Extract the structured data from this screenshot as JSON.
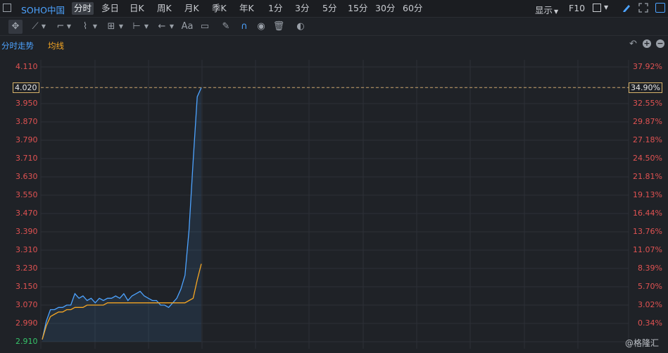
{
  "topbar": {
    "stock_name": "SOHO中国",
    "timeframes": [
      "分时",
      "多日",
      "日K",
      "周K",
      "月K",
      "季K",
      "年K",
      "1分",
      "3分",
      "5分",
      "15分",
      "30分",
      "60分"
    ],
    "active_timeframe": "分时",
    "display_label": "显示",
    "f10_label": "F10"
  },
  "toolbar": {
    "text_tool_label": "Aa"
  },
  "legend": {
    "price_line": "分时走势",
    "avg_line": "均线"
  },
  "colors": {
    "price_line": "#4da3ff",
    "avg_line": "#f5a623",
    "up": "#e05252",
    "down": "#36c46a",
    "current_price_line": "#caa36a"
  },
  "watermark": "@格隆汇",
  "chart_data": {
    "type": "line",
    "y_ticks": [
      "4.110",
      "4.020",
      "3.950",
      "3.870",
      "3.790",
      "3.710",
      "3.630",
      "3.550",
      "3.470",
      "3.390",
      "3.310",
      "3.230",
      "3.150",
      "3.070",
      "2.990",
      "2.910"
    ],
    "pct_ticks": [
      "37.92%",
      "34.90%",
      "32.55%",
      "29.87%",
      "27.18%",
      "24.50%",
      "21.81%",
      "19.13%",
      "16.44%",
      "13.76%",
      "11.07%",
      "8.39%",
      "5.70%",
      "3.02%",
      "0.34%"
    ],
    "current_price": "4.020",
    "current_pct": "34.90%",
    "ylim": [
      2.91,
      4.11
    ],
    "grid": true,
    "series": [
      {
        "name": "分时走势",
        "values": [
          2.92,
          3.0,
          3.05,
          3.05,
          3.06,
          3.06,
          3.07,
          3.07,
          3.12,
          3.1,
          3.11,
          3.09,
          3.1,
          3.08,
          3.1,
          3.09,
          3.1,
          3.1,
          3.11,
          3.1,
          3.12,
          3.09,
          3.11,
          3.12,
          3.13,
          3.11,
          3.1,
          3.09,
          3.09,
          3.07,
          3.07,
          3.06,
          3.08,
          3.1,
          3.14,
          3.2,
          3.4,
          3.7,
          3.98,
          4.02
        ]
      },
      {
        "name": "均线",
        "values": [
          2.92,
          2.98,
          3.02,
          3.03,
          3.04,
          3.04,
          3.05,
          3.05,
          3.06,
          3.06,
          3.06,
          3.07,
          3.07,
          3.07,
          3.07,
          3.07,
          3.08,
          3.08,
          3.08,
          3.08,
          3.08,
          3.08,
          3.08,
          3.08,
          3.08,
          3.08,
          3.08,
          3.08,
          3.08,
          3.08,
          3.08,
          3.08,
          3.08,
          3.08,
          3.08,
          3.08,
          3.09,
          3.1,
          3.18,
          3.25
        ]
      }
    ]
  }
}
